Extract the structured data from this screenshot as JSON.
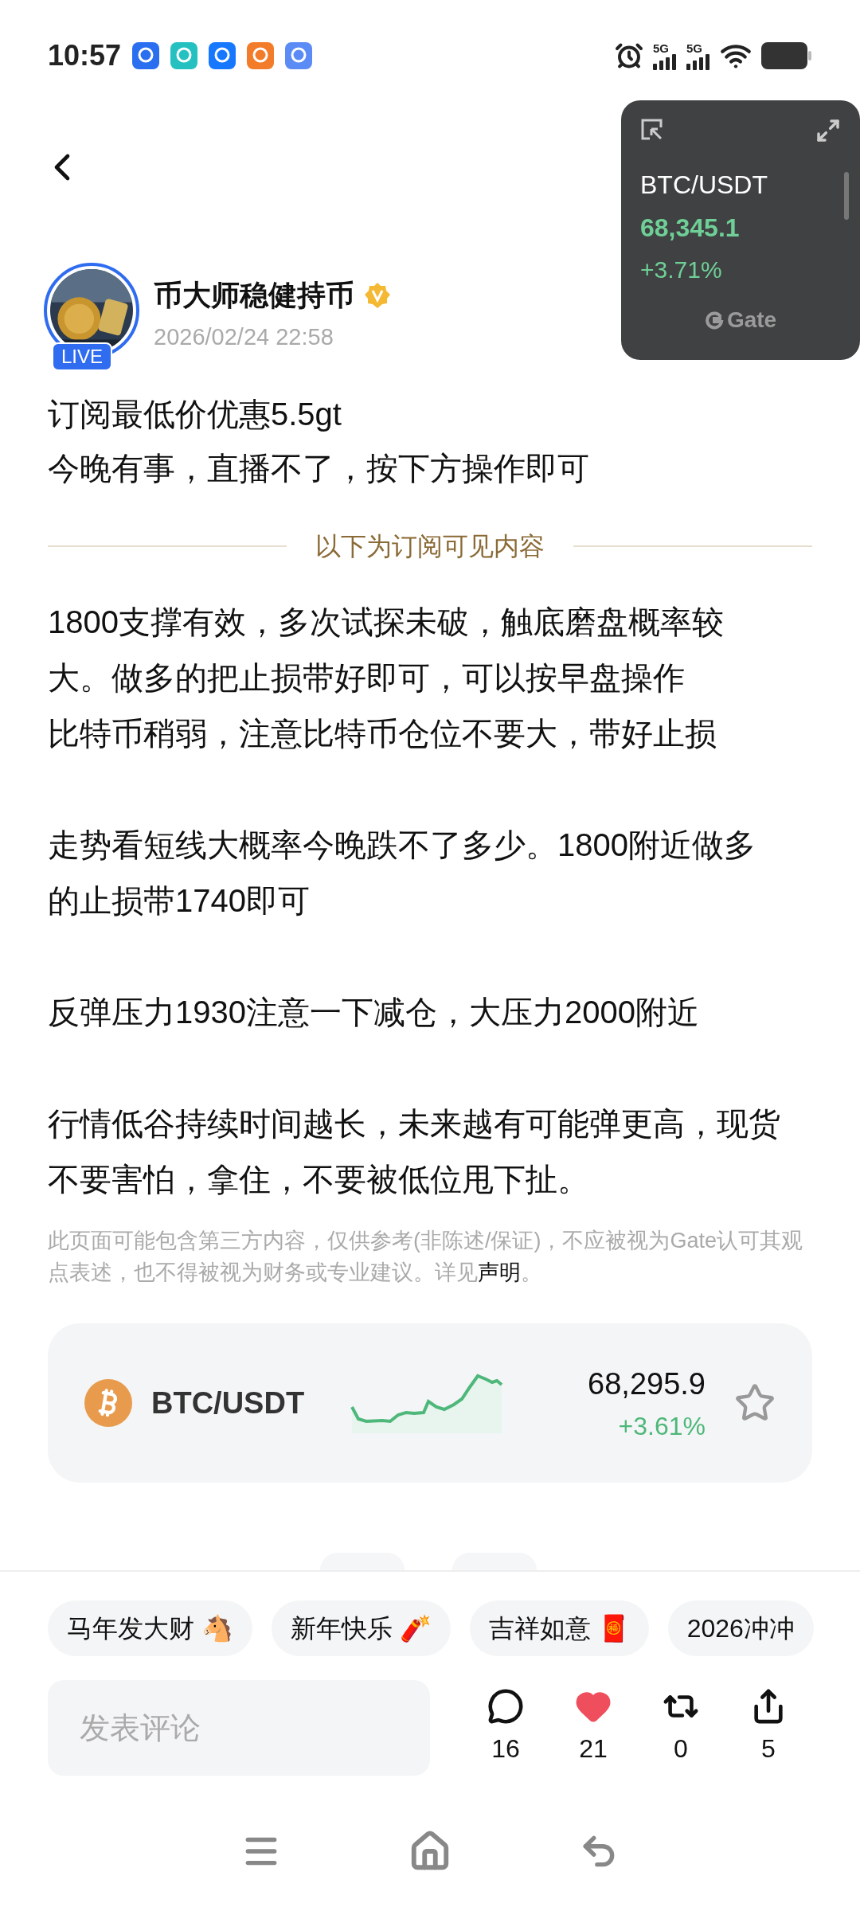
{
  "status_bar": {
    "time": "10:57",
    "signals": [
      "5G",
      "5G"
    ]
  },
  "ticker_widget": {
    "pair": "BTC/USDT",
    "price": "68,345.1",
    "change": "+3.71%",
    "brand": "Gate"
  },
  "author": {
    "name": "币大师稳健持币",
    "verified": true,
    "live_badge": "LIVE",
    "date": "2026/02/24 22:58"
  },
  "intro": [
    "订阅最低价优惠5.5gt",
    "今晚有事，直播不了，按下方操作即可"
  ],
  "divider_label": "以下为订阅可见内容",
  "paragraphs": [
    [
      "1800支撑有效，多次试探未破，触底磨盘概率较大。做多的把止损带好即可，可以按早盘操作",
      "比特币稍弱，注意比特币仓位不要大，带好止损"
    ],
    [
      "走势看短线大概率今晚跌不了多少。1800附近做多的止损带1740即可"
    ],
    [
      "反弹压力1930注意一下减仓，大压力2000附近"
    ],
    [
      "行情低谷持续时间越长，未来越有可能弹更高，现货不要害怕，拿住，不要被低位甩下扯。"
    ]
  ],
  "disclaimer": {
    "text": "此页面可能包含第三方内容，仅供参考(非陈述/保证)，不应被视为Gate认可其观点表述，也不得被视为财务或专业建议。详见",
    "link": "声明",
    "end": "。"
  },
  "market_card": {
    "pair": "BTC/USDT",
    "price": "68,295.9",
    "change": "+3.61%",
    "favorite": false
  },
  "chips": [
    "马年发大财 🐴",
    "新年快乐 🧨",
    "吉祥如意 🧧",
    "2026冲冲"
  ],
  "comment_field": {
    "placeholder": "发表评论"
  },
  "actions": [
    {
      "kind": "comment",
      "count": "16",
      "liked": false
    },
    {
      "kind": "like",
      "count": "21",
      "liked": true
    },
    {
      "kind": "repost",
      "count": "0",
      "liked": false
    },
    {
      "kind": "share",
      "count": "5",
      "liked": false
    }
  ]
}
